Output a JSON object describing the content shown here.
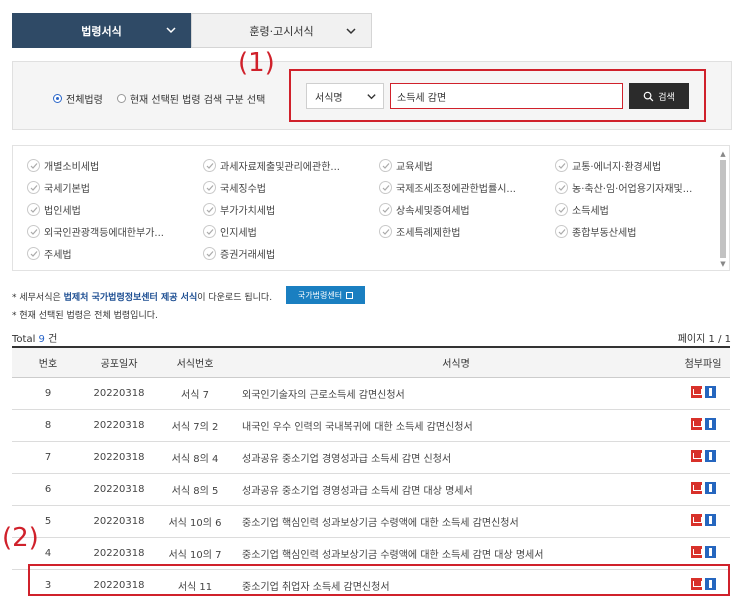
{
  "tabs": [
    {
      "label": "법령서식",
      "active": true
    },
    {
      "label": "훈령·고시서식",
      "active": false
    }
  ],
  "markers": {
    "one": "(1)",
    "two": "(2)"
  },
  "search": {
    "scope_options": [
      "전체법령",
      "현재 선택된 법령 검색 구분 선택"
    ],
    "selected_scope": "전체법령",
    "field_select": "서식명",
    "query": "소득세 감면",
    "button_label": "검색"
  },
  "laws": [
    "개별소비세법",
    "과세자료제출및관리에관한...",
    "교육세법",
    "교통·에너지·환경세법",
    "국세기본법",
    "국세징수법",
    "국제조세조정에관한법률시...",
    "농·축산·임·어업용기자재및...",
    "법인세법",
    "부가가치세법",
    "상속세및증여세법",
    "소득세법",
    "외국인관광객등에대한부가...",
    "인지세법",
    "조세특례제한법",
    "종합부동산세법",
    "주세법",
    "증권거래세법"
  ],
  "notes": {
    "line1_prefix": "* 세무서식은 ",
    "line1_bold": "법제처 국가법령정보센터 제공 서식",
    "line1_suffix": "이 다운로드 됩니다.",
    "center_button": "국가법령센터",
    "line2": "* 현재 선택된 법령은 전체 법령입니다."
  },
  "summary": {
    "total_prefix": "Total ",
    "total_count": "9",
    "total_suffix": " 건",
    "page_prefix": "페이지 ",
    "page_current": "1",
    "page_sep": " / ",
    "page_total": "1"
  },
  "table": {
    "headers": [
      "번호",
      "공포일자",
      "서식번호",
      "서식명",
      "첨부파일"
    ],
    "rows": [
      {
        "no": "9",
        "date": "20220318",
        "form": "서식 7",
        "name": "외국인기술자의 근로소득세 감면신청서"
      },
      {
        "no": "8",
        "date": "20220318",
        "form": "서식 7의 2",
        "name": "내국인 우수 인력의 국내복귀에 대한 소득세 감면신청서"
      },
      {
        "no": "7",
        "date": "20220318",
        "form": "서식 8의 4",
        "name": "성과공유 중소기업 경영성과급 소득세 감면 신청서"
      },
      {
        "no": "6",
        "date": "20220318",
        "form": "서식 8의 5",
        "name": "성과공유 중소기업 경영성과급 소득세 감면 대상 명세서"
      },
      {
        "no": "5",
        "date": "20220318",
        "form": "서식 10의 6",
        "name": "중소기업 핵심인력 성과보상기금 수령액에 대한 소득세 감면신청서"
      },
      {
        "no": "4",
        "date": "20220318",
        "form": "서식 10의 7",
        "name": "중소기업 핵심인력 성과보상기금 수령액에 대한 소득세 감면 대상 명세서"
      },
      {
        "no": "3",
        "date": "20220318",
        "form": "서식 11",
        "name": "중소기업 취업자 소득세 감면신청서"
      }
    ]
  },
  "colors": {
    "accent": "#2f4a66",
    "highlight": "#d0212b",
    "link": "#1a7fc1"
  }
}
